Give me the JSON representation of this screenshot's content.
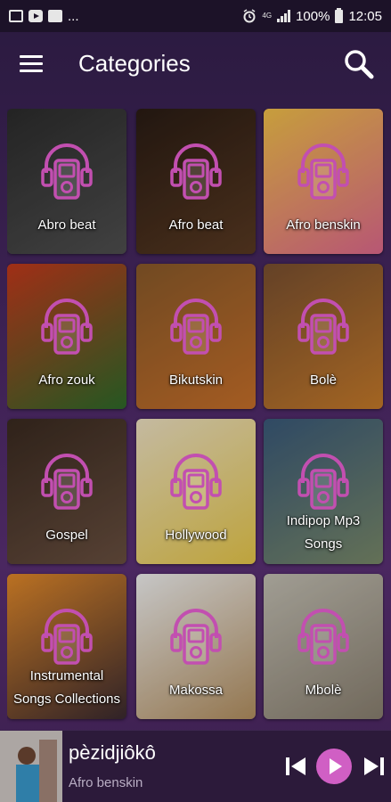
{
  "status_bar": {
    "dots": "...",
    "network": "4G",
    "battery": "100%",
    "time": "12:05"
  },
  "app_bar": {
    "title": "Categories"
  },
  "categories": [
    {
      "label": "Abro beat",
      "colors": [
        "#2c2c2c",
        "#505050"
      ]
    },
    {
      "label": "Afro beat",
      "colors": [
        "#2a1c14",
        "#5a3a22"
      ]
    },
    {
      "label": "Afro benskin",
      "colors": [
        "#f3c14a",
        "#e06a8e"
      ]
    },
    {
      "label": "Afro zouk",
      "colors": [
        "#c4391c",
        "#2e6b2a"
      ]
    },
    {
      "label": "Bikutskin",
      "colors": [
        "#8a5a2a",
        "#c8702a"
      ]
    },
    {
      "label": "Bolè",
      "colors": [
        "#7a5030",
        "#c77b2a"
      ]
    },
    {
      "label": "Gospel",
      "colors": [
        "#3a2a20",
        "#6a5040"
      ]
    },
    {
      "label": "Hollywood",
      "colors": [
        "#efe3c4",
        "#e8c84a"
      ]
    },
    {
      "label": "Indipop Mp3 Songs",
      "colors": [
        "#3a5a7a",
        "#7a8a6a"
      ]
    },
    {
      "label": "Instrumental Songs Collections",
      "colors": [
        "#e48a2a",
        "#3a2a30"
      ]
    },
    {
      "label": "Makossa",
      "colors": [
        "#f2f2f2",
        "#b49060"
      ]
    },
    {
      "label": "Mbolè",
      "colors": [
        "#c4c0b4",
        "#8a8070"
      ]
    }
  ],
  "player": {
    "track_title": "pèzidjiôkô",
    "artist": "Afro benskin"
  },
  "colors": {
    "accent": "#d05fc4",
    "icon_stroke": "#c24fb0"
  }
}
